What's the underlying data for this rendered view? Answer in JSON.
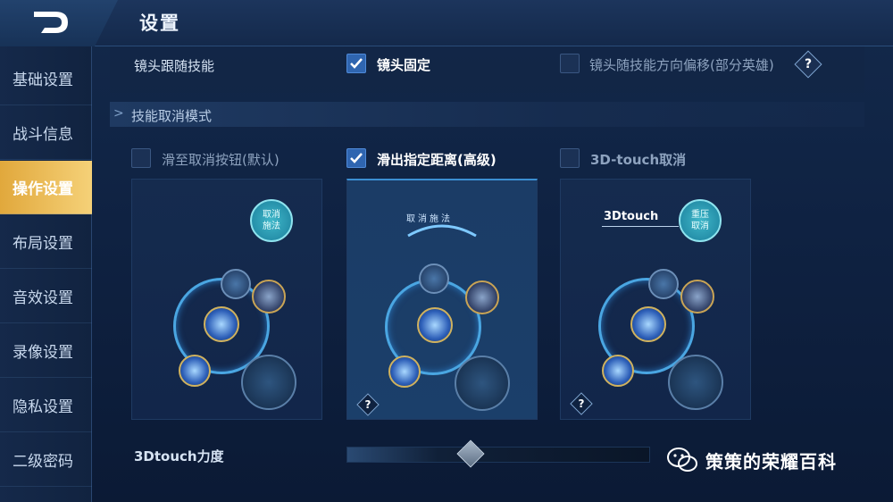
{
  "header": {
    "title": "设置"
  },
  "sidebar": {
    "items": [
      {
        "label": "基础设置",
        "active": false
      },
      {
        "label": "战斗信息",
        "active": false
      },
      {
        "label": "操作设置",
        "active": true
      },
      {
        "label": "布局设置",
        "active": false
      },
      {
        "label": "音效设置",
        "active": false
      },
      {
        "label": "录像设置",
        "active": false
      },
      {
        "label": "隐私设置",
        "active": false
      },
      {
        "label": "二级密码",
        "active": false
      }
    ]
  },
  "camera": {
    "label": "镜头跟随技能",
    "options": [
      {
        "label": "镜头固定",
        "checked": true
      },
      {
        "label": "镜头随技能方向偏移(部分英雄)",
        "checked": false
      }
    ],
    "help": "?"
  },
  "cancel_mode": {
    "section_title": "技能取消模式",
    "options": [
      {
        "label": "滑至取消按钮(默认)",
        "checked": false
      },
      {
        "label": "滑出指定距离(高级)",
        "checked": true
      },
      {
        "label": "3D-touch取消",
        "checked": false
      }
    ],
    "panels": [
      {
        "cancel_button": "取消施法",
        "help": ""
      },
      {
        "arc_label": "取消施法",
        "help": "?"
      },
      {
        "touch_label": "3Dtouch",
        "cancel_button": "重压取消",
        "help": "?"
      }
    ]
  },
  "touch_force": {
    "label": "3Dtouch力度",
    "value": 0.4
  },
  "watermark": {
    "text": "策策的荣耀百科"
  },
  "colors": {
    "accent_active": "#e9b44c",
    "check": "#2f65b0",
    "ring": "#4aa6e2"
  }
}
